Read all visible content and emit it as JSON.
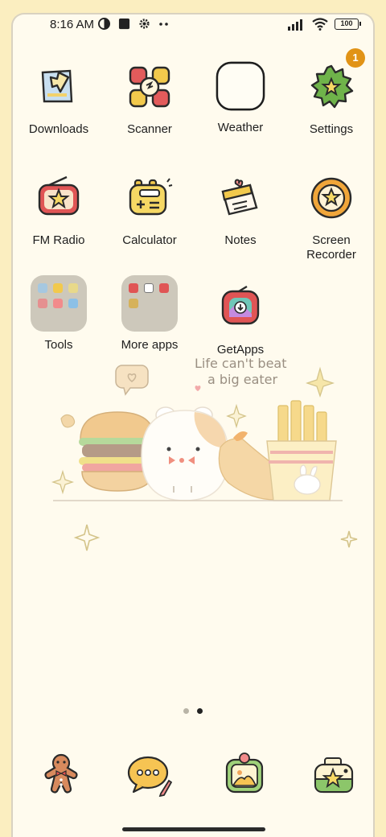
{
  "status_bar": {
    "time": "8:16 AM",
    "battery": "100",
    "icons": [
      "data-saver-icon",
      "square-icon",
      "gear-icon",
      "more-icon",
      "signal-icon",
      "wifi-icon",
      "battery-icon"
    ]
  },
  "badge": {
    "count": "1"
  },
  "apps": [
    {
      "label": "Downloads",
      "icon": "download-folder-icon"
    },
    {
      "label": "Scanner",
      "icon": "scanner-icon"
    },
    {
      "label": "Weather",
      "icon": "weather-blank-icon"
    },
    {
      "label": "Settings",
      "icon": "settings-gear-icon"
    },
    {
      "label": "FM Radio",
      "icon": "radio-icon"
    },
    {
      "label": "Calculator",
      "icon": "calculator-icon"
    },
    {
      "label": "Notes",
      "icon": "notes-icon"
    },
    {
      "label": "Screen Recorder",
      "icon": "screen-recorder-icon"
    },
    {
      "label": "Tools",
      "icon": "folder-icon"
    },
    {
      "label": "More apps",
      "icon": "folder-icon"
    },
    {
      "label": "GetApps",
      "icon": "getapps-icon"
    }
  ],
  "wallpaper": {
    "line1": "Life can't beat",
    "line2": "a big eater"
  },
  "dock": [
    {
      "icon": "gingerbread-icon"
    },
    {
      "icon": "messages-icon"
    },
    {
      "icon": "gallery-icon"
    },
    {
      "icon": "camera-icon"
    }
  ],
  "colors": {
    "background": "#fffbee",
    "border": "#fbeec0",
    "badge": "#e19316"
  }
}
